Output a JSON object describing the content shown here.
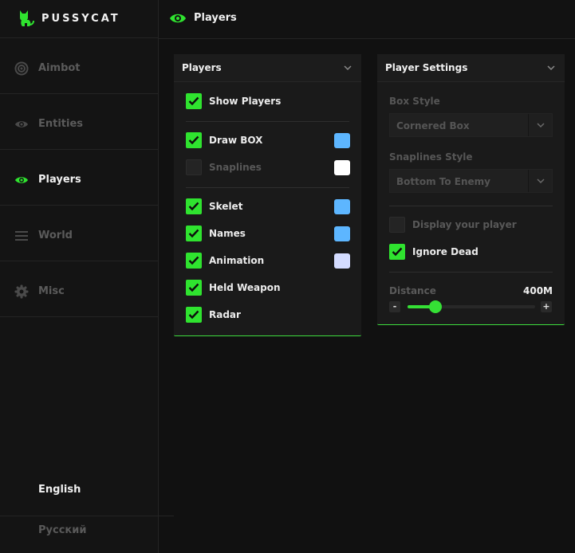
{
  "app": {
    "name": "PUSSYCAT",
    "logo_icon": "cat-icon",
    "accent": "#2fe32f"
  },
  "sidebar": {
    "items": [
      {
        "label": "Aimbot",
        "icon": "target-icon",
        "active": false
      },
      {
        "label": "Entities",
        "icon": "eye-icon",
        "active": false
      },
      {
        "label": "Players",
        "icon": "eye-icon",
        "active": true
      },
      {
        "label": "World",
        "icon": "menu-lines-icon",
        "active": false
      },
      {
        "label": "Misc",
        "icon": "gear-icon",
        "active": false
      }
    ],
    "languages": [
      {
        "label": "English",
        "active": true
      },
      {
        "label": "Русский",
        "active": false
      }
    ]
  },
  "topbar": {
    "title": "Players",
    "icon": "eye-icon"
  },
  "players_panel": {
    "title": "Players",
    "show_players": {
      "label": "Show Players",
      "checked": true
    },
    "draw_box": {
      "label": "Draw BOX",
      "checked": true,
      "color": "#5db6ff"
    },
    "snaplines": {
      "label": "Snaplines",
      "checked": false,
      "color": "#ffffff"
    },
    "skelet": {
      "label": "Skelet",
      "checked": true,
      "color": "#5db6ff"
    },
    "names": {
      "label": "Names",
      "checked": true,
      "color": "#5db6ff"
    },
    "animation": {
      "label": "Animation",
      "checked": true,
      "color": "#d4dcff"
    },
    "held_weapon": {
      "label": "Held Weapon",
      "checked": true
    },
    "radar": {
      "label": "Radar",
      "checked": true
    }
  },
  "settings_panel": {
    "title": "Player Settings",
    "box_style": {
      "label": "Box Style",
      "value": "Cornered Box"
    },
    "snaplines_style": {
      "label": "Snaplines Style",
      "value": "Bottom To Enemy"
    },
    "display_player": {
      "label": "Display your player",
      "checked": false
    },
    "ignore_dead": {
      "label": "Ignore Dead",
      "checked": true
    },
    "distance": {
      "label": "Distance",
      "value": "400M",
      "fraction": 0.22,
      "minus": "-",
      "plus": "+"
    }
  }
}
